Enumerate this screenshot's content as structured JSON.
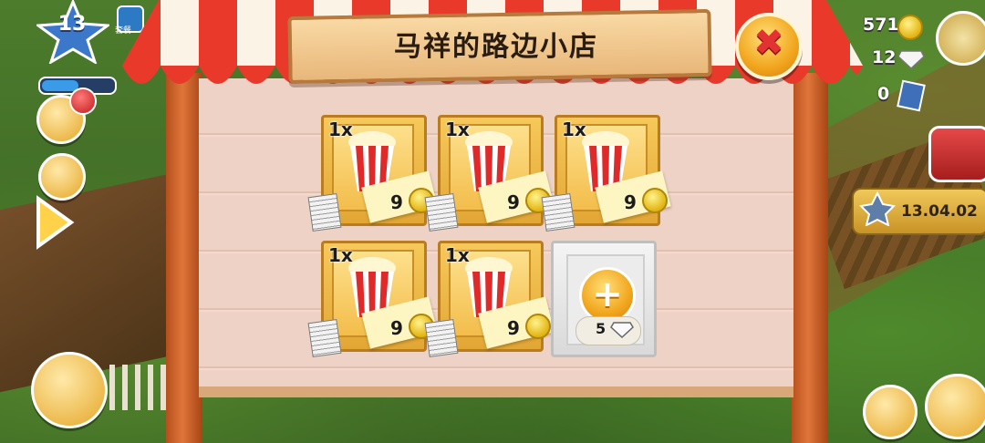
{
  "stand": {
    "title": "马祥的路边小店",
    "close_symbol": "✖"
  },
  "slots": [
    {
      "quantity": "1x",
      "item": "popcorn",
      "price": "9"
    },
    {
      "quantity": "1x",
      "item": "popcorn",
      "price": "9"
    },
    {
      "quantity": "1x",
      "item": "popcorn",
      "price": "9"
    },
    {
      "quantity": "1x",
      "item": "popcorn",
      "price": "9"
    },
    {
      "quantity": "1x",
      "item": "popcorn",
      "price": "9"
    }
  ],
  "buy_slot": {
    "plus_symbol": "+",
    "gem_cost": "5"
  },
  "hud": {
    "level": "13",
    "coop_label": "套餐",
    "coins": "571",
    "diamonds": "12",
    "vouchers": "0",
    "timer": "13.04.02"
  },
  "colors": {
    "awning_red": "#e8392b",
    "awning_white": "#fbf3e6",
    "coin_gold": "#e2b412"
  }
}
